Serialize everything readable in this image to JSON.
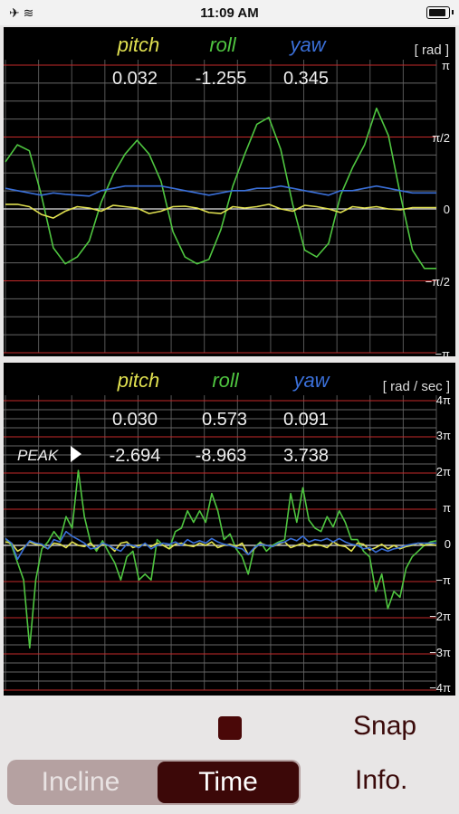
{
  "status_bar": {
    "time": "11:09 AM",
    "signal": "✈ ≋"
  },
  "angle_panel": {
    "unit": "[ rad ]",
    "headers": [
      {
        "label": "pitch",
        "color": "#e0e050"
      },
      {
        "label": "roll",
        "color": "#4fc540"
      },
      {
        "label": "yaw",
        "color": "#3a6fd8"
      }
    ],
    "values": [
      "0.032",
      "-1.255",
      "0.345"
    ],
    "axis_labels": [
      "π",
      "π/2",
      "0",
      "−π/2",
      "−π"
    ]
  },
  "rate_panel": {
    "unit": "[ rad / sec ]",
    "headers": [
      {
        "label": "pitch",
        "color": "#e0e050"
      },
      {
        "label": "roll",
        "color": "#4fc540"
      },
      {
        "label": "yaw",
        "color": "#3a6fd8"
      }
    ],
    "values": [
      "0.030",
      "0.573",
      "0.091"
    ],
    "peak_label": "PEAK",
    "peak_values": [
      "-2.694",
      "-8.963",
      "3.738"
    ],
    "axis_labels": [
      "4π",
      "3π",
      "2π",
      "π",
      "0",
      "−π",
      "−2π",
      "−3π",
      "−4π"
    ]
  },
  "chart_data": [
    {
      "type": "line",
      "title": "",
      "ylabel": "[ rad ]",
      "ylim": [
        -3.1416,
        3.1416
      ],
      "y_ticks": [
        "π",
        "π/2",
        "0",
        "−π/2",
        "−π"
      ],
      "series": [
        {
          "name": "roll",
          "color": "#4fc540",
          "values": [
            1.03,
            1.4,
            1.27,
            0.3,
            -0.85,
            -1.2,
            -1.05,
            -0.7,
            0.15,
            0.75,
            1.2,
            1.5,
            1.2,
            0.6,
            -0.5,
            -1.05,
            -1.2,
            -1.1,
            -0.45,
            0.5,
            1.2,
            1.85,
            2.0,
            1.3,
            0.1,
            -0.9,
            -1.05,
            -0.75,
            0.3,
            0.9,
            1.4,
            2.2,
            1.6,
            0.3,
            -0.9,
            -1.3,
            -1.3
          ]
        },
        {
          "name": "pitch",
          "color": "#e0e050",
          "values": [
            0.1,
            0.1,
            0.05,
            -0.12,
            -0.2,
            -0.05,
            0.05,
            0.02,
            -0.05,
            0.08,
            0.05,
            0.02,
            -0.1,
            -0.05,
            0.05,
            0.06,
            0.02,
            -0.08,
            -0.1,
            0.05,
            0.02,
            0.05,
            0.1,
            0.0,
            -0.05,
            0.08,
            0.05,
            0.0,
            -0.08,
            0.05,
            0.02,
            0.05,
            0.0,
            -0.02,
            0.03,
            0.03,
            0.03
          ]
        },
        {
          "name": "yaw",
          "color": "#3a6fd8",
          "values": [
            0.45,
            0.4,
            0.35,
            0.3,
            0.35,
            0.32,
            0.3,
            0.28,
            0.4,
            0.45,
            0.5,
            0.5,
            0.5,
            0.5,
            0.45,
            0.4,
            0.35,
            0.3,
            0.35,
            0.4,
            0.4,
            0.45,
            0.45,
            0.5,
            0.45,
            0.4,
            0.35,
            0.3,
            0.4,
            0.4,
            0.45,
            0.5,
            0.45,
            0.4,
            0.35,
            0.35,
            0.35
          ]
        }
      ]
    },
    {
      "type": "line",
      "title": "",
      "ylabel": "[ rad / sec ]",
      "ylim": [
        -12.566,
        12.566
      ],
      "y_ticks": [
        "4π",
        "3π",
        "2π",
        "π",
        "0",
        "−π",
        "−2π",
        "−3π",
        "−4π"
      ],
      "series": [
        {
          "name": "roll",
          "color": "#4fc540",
          "values": [
            0.6,
            0.0,
            -1.5,
            -3.0,
            -8.9,
            -3.0,
            -0.3,
            0.3,
            1.2,
            0.5,
            2.5,
            1.5,
            6.5,
            2.5,
            0.3,
            -0.5,
            0.4,
            -0.6,
            -1.5,
            -3.0,
            -1.0,
            -0.5,
            -3.0,
            -2.5,
            -3.0,
            0.5,
            0.0,
            -0.3,
            1.2,
            1.5,
            3.0,
            2.0,
            3.0,
            2.0,
            4.5,
            3.0,
            0.5,
            1.0,
            -0.3,
            -1.0,
            -2.5,
            -0.2,
            0.3,
            -0.5,
            0.0,
            0.3,
            0.5,
            4.5,
            2.0,
            5.0,
            2.2,
            1.5,
            1.2,
            2.5,
            1.6,
            3.0,
            2.0,
            0.5,
            0.5,
            -0.5,
            -1.0,
            -4.0,
            -2.5,
            -5.5,
            -4.0,
            -4.5,
            -2.0,
            -1.0,
            -0.5,
            0.0,
            0.3,
            0.4
          ]
        },
        {
          "name": "pitch",
          "color": "#e0e050",
          "values": [
            0.3,
            0.2,
            -0.5,
            -0.2,
            0.3,
            0.1,
            0.0,
            -0.3,
            0.2,
            0.1,
            -0.2,
            0.3,
            0.0,
            -0.1,
            0.2,
            -0.3,
            0.1,
            0.0,
            -0.5,
            0.2,
            0.3,
            -0.2,
            0.0,
            0.1,
            -0.1,
            0.2,
            0.0,
            -0.3,
            0.1,
            0.2,
            0.0,
            -0.1,
            0.2,
            0.0,
            0.3,
            -0.2,
            0.0,
            0.1,
            -0.1,
            0.2,
            -0.8,
            -0.3,
            0.2,
            0.0,
            -0.1,
            0.1,
            0.3,
            -0.2,
            0.0,
            0.2,
            -0.1,
            0.1,
            0.0,
            -0.2,
            0.3,
            0.0,
            -0.1,
            -0.5,
            0.2,
            0.1,
            -0.4,
            -0.2,
            0.1,
            -0.3,
            0.0,
            -0.3,
            -0.1,
            0.0,
            0.2,
            0.0,
            0.1,
            0.0
          ]
        },
        {
          "name": "yaw",
          "color": "#3a6fd8",
          "values": [
            0.6,
            0.2,
            -1.2,
            -0.3,
            0.4,
            0.2,
            0.1,
            -0.3,
            0.5,
            0.3,
            1.2,
            0.8,
            0.5,
            0.2,
            -0.3,
            -0.2,
            0.2,
            0.0,
            -0.3,
            -0.5,
            0.1,
            0.0,
            -0.2,
            0.2,
            -0.3,
            0.0,
            0.2,
            0.1,
            0.3,
            0.0,
            0.5,
            0.2,
            0.4,
            0.2,
            0.6,
            0.3,
            0.1,
            0.0,
            -0.2,
            -0.3,
            -0.8,
            -0.2,
            0.1,
            0.0,
            -0.1,
            0.2,
            0.3,
            0.6,
            0.4,
            0.8,
            0.3,
            0.5,
            0.4,
            0.6,
            0.3,
            0.6,
            0.3,
            0.1,
            0.0,
            -0.3,
            -0.2,
            -0.6,
            -0.3,
            -0.5,
            -0.3,
            -0.2,
            0.0,
            0.1,
            0.2,
            0.2,
            0.2,
            0.2
          ]
        }
      ]
    }
  ],
  "controls": {
    "snap_label": "Snap",
    "info_label": "Info.",
    "segments": [
      "Incline",
      "Time"
    ],
    "selected_segment": "Time"
  }
}
